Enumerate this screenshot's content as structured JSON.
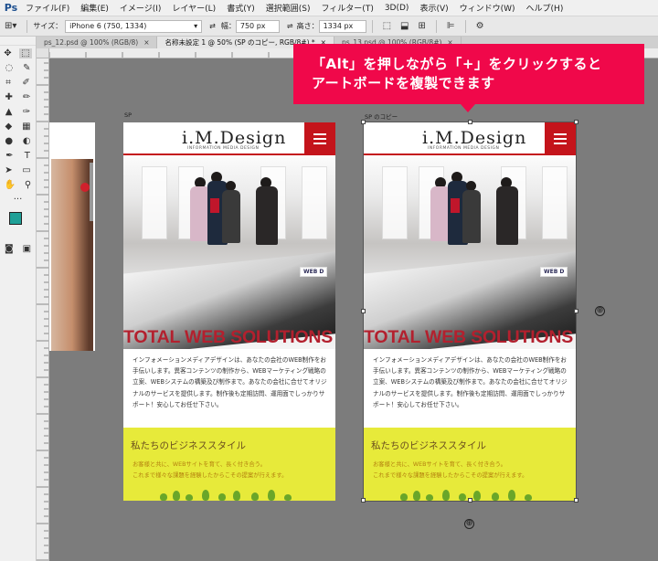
{
  "menubar": {
    "logo": "Ps",
    "items": [
      "ファイル(F)",
      "編集(E)",
      "イメージ(I)",
      "レイヤー(L)",
      "書式(Y)",
      "選択範囲(S)",
      "フィルター(T)",
      "3D(D)",
      "表示(V)",
      "ウィンドウ(W)",
      "ヘルプ(H)"
    ]
  },
  "optionsbar": {
    "size_label": "サイズ：",
    "size_value": "iPhone 6 (750, 1334)",
    "width_label": "幅：",
    "width_value": "750 px",
    "height_label": "高さ：",
    "height_value": "1334 px"
  },
  "tabs": [
    {
      "label": "ps_12.psd @ 100% (RGB/8)",
      "close": "×"
    },
    {
      "label": "名称未設定 1 @ 50% (SP のコピー, RGB/8#) *",
      "close": "×"
    },
    {
      "label": "ps_13.psd @ 100% (RGB/8#)",
      "close": "×"
    }
  ],
  "artboards": [
    {
      "label": "SP",
      "logo": "i.M.Design",
      "logo_sub": "INFORMATION MEDIA DESIGN",
      "photo_sign": "WEB D",
      "title": "TOTAL WEB SOLUTIONS",
      "body": "インフォメーションメディアデザインは、あなたの会社のWEB制作をお手伝いします。異客コンテンツの制作から、WEBマーケティング戦略の立案、WEBシステムの構築及び制作まで。あなたの会社に合せてオリジナルのサービスを提供します。制作後も定期訪問、運用面でしっかりサポート！安心してお任せ下さい。",
      "section_title": "私たちのビジネススタイル",
      "section_text_1": "お客様と共に、WEBサイトを育て、長く付き合う。",
      "section_text_2": "これまで様々な課題を経験したからこその提案が行えます。"
    },
    {
      "label": "SP のコピー",
      "logo": "i.M.Design",
      "logo_sub": "INFORMATION MEDIA DESIGN",
      "photo_sign": "WEB D",
      "title": "TOTAL WEB SOLUTIONS",
      "body": "インフォメーションメディアデザインは、あなたの会社のWEB制作をお手伝いします。異客コンテンツの制作から、WEBマーケティング戦略の立案、WEBシステムの構築及び制作まで。あなたの会社に合せてオリジナルのサービスを提供します。制作後も定期訪問、運用面でしっかりサポート！安心してお任せ下さい。",
      "section_title": "私たちのビジネススタイル",
      "section_text_1": "お客様と共に、WEBサイトを育て、長く付き合う。",
      "section_text_2": "これまで様々な課題を経験したからこその提案が行えます。"
    }
  ],
  "callout": {
    "line1": "「Alt」を押しながら「+」をクリックすると",
    "line2": "アートボードを複製できます"
  },
  "colors": {
    "accent_red": "#c4141b",
    "callout_pink": "#f0084a",
    "section_yellow": "#e7ea3a",
    "foreground_swatch": "#1fa097"
  },
  "icons": {
    "add_artboard": "⊕"
  }
}
